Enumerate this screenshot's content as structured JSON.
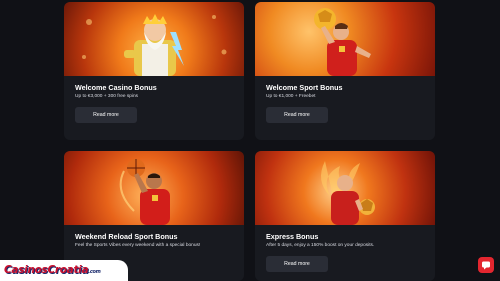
{
  "cards": [
    {
      "title": "Welcome Casino Bonus",
      "description": "Up to €3,000 + 300 free spins",
      "button": "Read more",
      "image": "zeus-character-image"
    },
    {
      "title": "Welcome Sport Bonus",
      "description": "Up to €1,000 + Freebet",
      "button": "Read more",
      "image": "football-player-image"
    },
    {
      "title": "Weekend Reload Sport Bonus",
      "description": "Feel the Sports Vibes every weekend with a special bonus!",
      "button": "Read more",
      "image": "basketball-player-image"
    },
    {
      "title": "Express Bonus",
      "description": "After 5 days, enjoy a 150% boost on your deposits.",
      "button": "Read more",
      "image": "flaming-football-player-image"
    }
  ],
  "watermark": {
    "text": "CasinosCroatia",
    "suffix": ".com"
  },
  "colors": {
    "background": "#101116",
    "card": "#181a20",
    "button": "#2a2d36",
    "chat_accent": "#e3262f",
    "brand_red": "#c8102e",
    "brand_navy": "#1a2a6c"
  },
  "icons": {
    "chat": "chat-bubble-icon"
  }
}
